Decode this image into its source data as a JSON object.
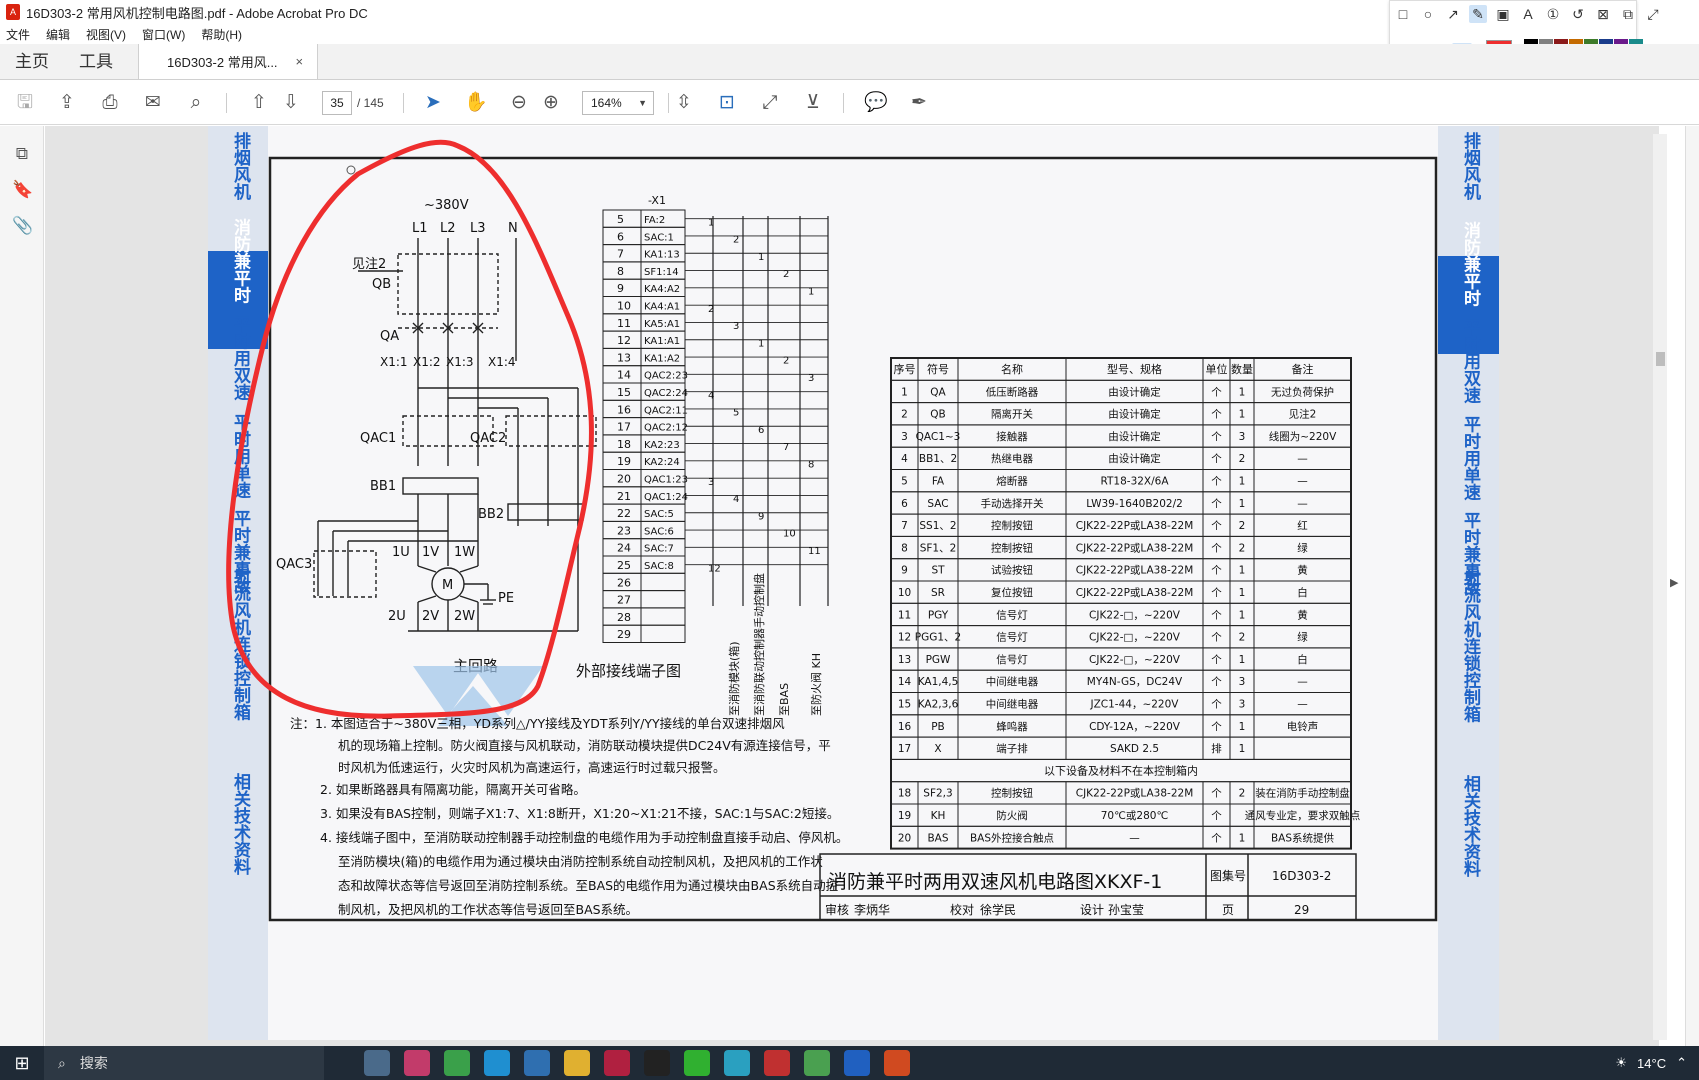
{
  "window": {
    "title": "16D303-2 常用风机控制电路图.pdf - Adobe Acrobat Pro DC"
  },
  "menu": [
    "文件",
    "编辑",
    "视图(V)",
    "窗口(W)",
    "帮助(H)"
  ],
  "tabs": {
    "home": "主页",
    "tools": "工具",
    "document": "16D303-2 常用风...",
    "close": "×"
  },
  "toolbar": {
    "page_current": "35",
    "page_total": "/ 145",
    "zoom": "164%"
  },
  "colors": {
    "annotation_red": "#ee2e2e",
    "accent": "#2a6ebb",
    "blueband": "#1e63c7"
  },
  "taskbar": {
    "search_label": "搜索",
    "temperature": "14°C"
  },
  "drawing": {
    "supply": "~380V",
    "phases": [
      "L1",
      "L2",
      "L3",
      "N"
    ],
    "see_note": "见注2",
    "labels": {
      "qb": "QB",
      "qa": "QA",
      "qac1": "QAC1",
      "qac2": "QAC2",
      "qac3": "QAC3",
      "bb1": "BB1",
      "bb2": "BB2",
      "motor": "M",
      "pe": "PE"
    },
    "terminals_x1": [
      "X1:1",
      "X1:2",
      "X1:3",
      "X1:4"
    ],
    "windings_top": [
      "1U",
      "1V",
      "1W"
    ],
    "windings_bottom": [
      "2U",
      "2V",
      "2W"
    ],
    "main_circuit": "主回路",
    "external_terminal": "外部接线端子图",
    "x1_header": "-X1",
    "terminal_rows": [
      [
        "5",
        "FA:2"
      ],
      [
        "6",
        "SAC:1"
      ],
      [
        "7",
        "KA1:13"
      ],
      [
        "8",
        "SF1:14"
      ],
      [
        "9",
        "KA4:A2"
      ],
      [
        "10",
        "KA4:A1"
      ],
      [
        "11",
        "KA5:A1"
      ],
      [
        "12",
        "KA1:A1"
      ],
      [
        "13",
        "KA1:A2"
      ],
      [
        "14",
        "QAC2:23"
      ],
      [
        "15",
        "QAC2:24"
      ],
      [
        "16",
        "QAC2:11"
      ],
      [
        "17",
        "QAC2:12"
      ],
      [
        "18",
        "KA2:23"
      ],
      [
        "19",
        "KA2:24"
      ],
      [
        "20",
        "QAC1:23"
      ],
      [
        "21",
        "QAC1:24"
      ],
      [
        "22",
        "SAC:5"
      ],
      [
        "23",
        "SAC:6"
      ],
      [
        "24",
        "SAC:7"
      ],
      [
        "25",
        "SAC:8"
      ],
      [
        "26",
        ""
      ],
      [
        "27",
        ""
      ],
      [
        "28",
        ""
      ],
      [
        "29",
        ""
      ]
    ],
    "cable_labels": [
      "至消防模块(箱)",
      "至消防联动控制器手动控制盘",
      "至BAS",
      "至防火阀 KH"
    ],
    "wire_numbers": [
      "1",
      "2",
      "1",
      "2",
      "1",
      "2",
      "3",
      "1",
      "2",
      "3",
      "4",
      "5",
      "6",
      "7",
      "8",
      "3",
      "4",
      "9",
      "10",
      "11",
      "12"
    ],
    "left_band": [
      "排烟风机",
      "消防兼平时",
      "平时用双速",
      "平时用单速",
      "平时兼事故",
      "射流风机连锁控制箱",
      "相关技术资料"
    ],
    "right_band": [
      "排烟风机",
      "消防兼平时",
      "平时用双速",
      "平时用单速",
      "平时兼事故",
      "射流风机连锁控制箱",
      "相关技术资料"
    ],
    "notes": [
      "注：1. 本图适合于~380V三相，YD系列△/YY接线及YDT系列Y/YY接线的单台双速排烟风",
      "机的现场箱上控制。防火阀直接与风机联动，消防联动模块提供DC24V有源连接信号，平",
      "时风机为低速运行，火灾时风机为高速运行，高速运行时过载只报警。",
      "2. 如果断路器具有隔离功能，隔离开关可省略。",
      "3. 如果没有BAS控制，则端子X1:7、X1:8断开，X1:20~X1:21不接，SAC:1与SAC:2短接。",
      "4. 接线端子图中，至消防联动控制器手动控制盘的电缆作用为手动控制盘直接手动启、停风机。",
      "至消防模块(箱)的电缆作用为通过模块由消防控制系统自动控制风机，及把风机的工作状",
      "态和故障状态等信号返回至消防控制系统。至BAS的电缆作用为通过模块由BAS系统自动控",
      "制风机，及把风机的工作状态等信号返回至BAS系统。"
    ],
    "table_headers": [
      "序号",
      "符号",
      "名称",
      "型号、规格",
      "单位",
      "数量",
      "备注"
    ],
    "table_rows": [
      [
        "1",
        "QA",
        "低压断路器",
        "由设计确定",
        "个",
        "1",
        "无过负荷保护"
      ],
      [
        "2",
        "QB",
        "隔离开关",
        "由设计确定",
        "个",
        "1",
        "见注2"
      ],
      [
        "3",
        "QAC1~3",
        "接触器",
        "由设计确定",
        "个",
        "3",
        "线圈为~220V"
      ],
      [
        "4",
        "BB1、2",
        "热继电器",
        "由设计确定",
        "个",
        "2",
        "—"
      ],
      [
        "5",
        "FA",
        "熔断器",
        "RT18-32X/6A",
        "个",
        "1",
        "—"
      ],
      [
        "6",
        "SAC",
        "手动选择开关",
        "LW39-1640B202/2",
        "个",
        "1",
        "—"
      ],
      [
        "7",
        "SS1、2",
        "控制按钮",
        "CJK22-22P或LA38-22M",
        "个",
        "2",
        "红"
      ],
      [
        "8",
        "SF1、2",
        "控制按钮",
        "CJK22-22P或LA38-22M",
        "个",
        "2",
        "绿"
      ],
      [
        "9",
        "ST",
        "试验按钮",
        "CJK22-22P或LA38-22M",
        "个",
        "1",
        "黄"
      ],
      [
        "10",
        "SR",
        "复位按钮",
        "CJK22-22P或LA38-22M",
        "个",
        "1",
        "白"
      ],
      [
        "11",
        "PGY",
        "信号灯",
        "CJK22-□，~220V",
        "个",
        "1",
        "黄"
      ],
      [
        "12",
        "PGG1、2",
        "信号灯",
        "CJK22-□，~220V",
        "个",
        "2",
        "绿"
      ],
      [
        "13",
        "PGW",
        "信号灯",
        "CJK22-□，~220V",
        "个",
        "1",
        "白"
      ],
      [
        "14",
        "KA1,4,5",
        "中间继电器",
        "MY4N-GS，DC24V",
        "个",
        "3",
        "—"
      ],
      [
        "15",
        "KA2,3,6",
        "中间继电器",
        "JZC1-44，~220V",
        "个",
        "3",
        "—"
      ],
      [
        "16",
        "PB",
        "蜂鸣器",
        "CDY-12A，~220V",
        "个",
        "1",
        "电铃声"
      ],
      [
        "17",
        "X",
        "端子排",
        "SAKD 2.5",
        "排",
        "1",
        ""
      ]
    ],
    "table_subheader": "以下设备及材料不在本控制箱内",
    "table_rows_ext": [
      [
        "18",
        "SF2,3",
        "控制按钮",
        "CJK22-22P或LA38-22M",
        "个",
        "2",
        "装在消防手动控制盘"
      ],
      [
        "19",
        "KH",
        "防火阀",
        "70℃或280℃",
        "个",
        "",
        "通风专业定，要求双触点"
      ],
      [
        "20",
        "BAS",
        "BAS外控接合触点",
        "—",
        "个",
        "1",
        "BAS系统提供"
      ]
    ],
    "title_block": {
      "title": "消防兼平时两用双速风机电路图XKXF-1",
      "atlas_label": "图集号",
      "atlas_no": "16D303-2",
      "review_label": "审核",
      "reviewer": "李炳华",
      "check_label": "校对",
      "checker": "徐学民",
      "design_label": "设计",
      "designer": "孙宝莹",
      "page_label": "页",
      "page_no": "29"
    }
  }
}
